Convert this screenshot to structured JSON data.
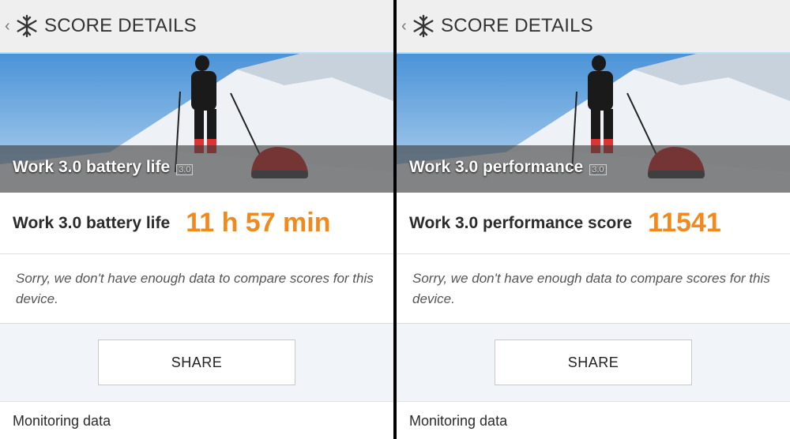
{
  "header": {
    "back_glyph": "‹",
    "title": "SCORE DETAILS"
  },
  "panels": [
    {
      "hero_label": "Work 3.0 battery life",
      "hero_version": "3.0",
      "score_label": "Work 3.0 battery life",
      "score_value": "11 h 57 min",
      "note": "Sorry, we don't have enough data to compare scores for this device.",
      "share_label": "SHARE",
      "monitoring_label": "Monitoring data"
    },
    {
      "hero_label": "Work 3.0 performance",
      "hero_version": "3.0",
      "score_label": "Work 3.0 performance score",
      "score_value": "11541",
      "note": "Sorry, we don't have enough data to compare scores for this device.",
      "share_label": "SHARE",
      "monitoring_label": "Monitoring data"
    }
  ],
  "colors": {
    "accent": "#f08a1e",
    "divider": "#bfe0f4"
  }
}
